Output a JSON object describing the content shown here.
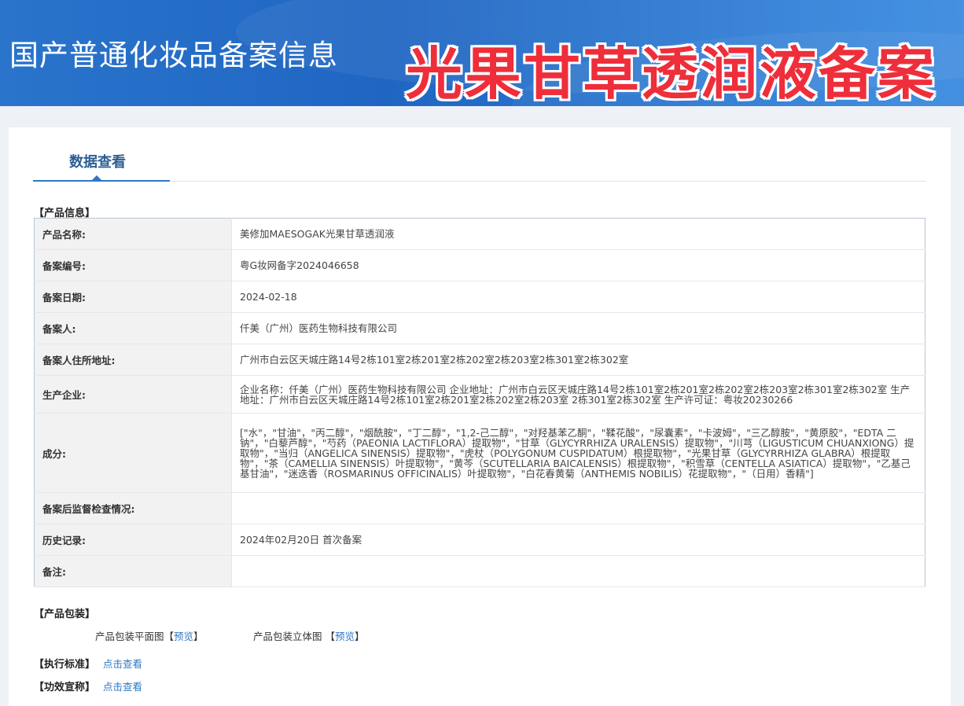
{
  "header": {
    "title": "国产普通化妆品备案信息",
    "watermark": "光果甘草透润液备案"
  },
  "tab": {
    "label": "数据查看"
  },
  "sections": {
    "product_info": "【产品信息】",
    "packaging": "【产品包装】",
    "standard": "【执行标准】",
    "efficacy": "【功效宣称】"
  },
  "table": {
    "rows": [
      {
        "key": "产品名称:",
        "value": "美修加MAESOGAK光果甘草透润液"
      },
      {
        "key": "备案编号:",
        "value": "粤G妆网备字2024046658"
      },
      {
        "key": "备案日期:",
        "value": "2024-02-18"
      },
      {
        "key": "备案人:",
        "value": "仟美（广州）医药生物科技有限公司"
      },
      {
        "key": "备案人住所地址:",
        "value": "广州市白云区天城庄路14号2栋101室2栋201室2栋202室2栋203室2栋301室2栋302室"
      },
      {
        "key": "生产企业:",
        "value": "企业名称：仟美（广州）医药生物科技有限公司 企业地址：广州市白云区天城庄路14号2栋101室2栋201室2栋202室2栋203室2栋301室2栋302室 生产地址：广州市白云区天城庄路14号2栋101室2栋201室2栋202室2栋203室 2栋301室2栋302室 生产许可证：粤妆20230266"
      },
      {
        "key": "成分:",
        "value": "[\"水\"，\"甘油\"，\"丙二醇\"，\"烟酰胺\"，\"丁二醇\"，\"1,2-己二醇\"，\"对羟基苯乙酮\"，\"鞣花酸\"，\"尿囊素\"，\"卡波姆\"，\"三乙醇胺\"，\"黄原胶\"，\"EDTA 二钠\"，\"白藜芦醇\"，\"芍药（PAEONIA LACTIFLORA）提取物\"，\"甘草（GLYCYRRHIZA URALENSIS）提取物\"，\"川芎（LIGUSTICUM CHUANXIONG）提取物\"，\"当归（ANGELICA SINENSIS）提取物\"，\"虎杖（POLYGONUM CUSPIDATUM）根提取物\"，\"光果甘草（GLYCYRRHIZA GLABRA）根提取物\"，\"茶（CAMELLIA SINENSIS）叶提取物\"，\"黄芩（SCUTELLARIA BAICALENSIS）根提取物\"，\"积雪草（CENTELLA ASIATICA）提取物\"，\"乙基己基甘油\"，\"迷迭香（ROSMARINUS OFFICINALIS）叶提取物\"，\"白花春黄菊（ANTHEMIS NOBILIS）花提取物\"，\"（日用）香精\"]"
      },
      {
        "key": "备案后监督检查情况:",
        "value": ""
      },
      {
        "key": "历史记录:",
        "value": "2024年02月20日 首次备案"
      },
      {
        "key": "备注:",
        "value": ""
      }
    ]
  },
  "packaging": {
    "flat_label": "产品包装平面图",
    "solid_label": "产品包装立体图",
    "preview": "预览",
    "bracket_open": "【",
    "bracket_close": "】"
  },
  "links": {
    "view": "点击查看"
  }
}
